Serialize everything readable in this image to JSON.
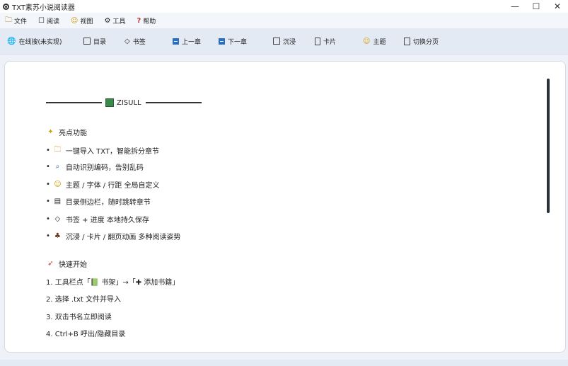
{
  "window": {
    "title": "TXT素苏小说阅读器"
  },
  "menu": [
    {
      "icon": "folder-icon",
      "glyph": "🗀",
      "label": "文件"
    },
    {
      "icon": "window-icon",
      "glyph": "☐",
      "label": "阅读"
    },
    {
      "icon": "smiley-icon",
      "glyph": "☺",
      "label": "视图"
    },
    {
      "icon": "gear-icon",
      "glyph": "⚙",
      "label": "工具"
    },
    {
      "icon": "question-icon",
      "glyph": "?",
      "label": "帮助"
    }
  ],
  "toolbar": {
    "progress": "在线搜(未实现)",
    "toc": "目录",
    "bookmark": "书签",
    "prev": "上一章",
    "next": "下一章",
    "immersive": "沉浸",
    "card": "卡片",
    "theme": "主题",
    "paging": "切换分页"
  },
  "content": {
    "brand": "ZISULL",
    "features_title": "亮点功能",
    "features": [
      "一键导入 TXT，智能拆分章节",
      "自动识别编码，告别乱码",
      "主题 / 字体 / 行距 全局自定义",
      "目录侧边栏，随时跳转章节",
      "书签 + 进度 本地持久保存",
      "沉浸 / 卡片 / 翻页动画 多种阅读姿势"
    ],
    "quick_title": "快速开始",
    "steps": [
      "1. 工具栏点「📗 书架」→「✚ 添加书籍」",
      "2. 选择 .txt 文件并导入",
      "3. 双击书名立即阅读",
      "4. Ctrl+B 呼出/隐藏目录"
    ]
  }
}
